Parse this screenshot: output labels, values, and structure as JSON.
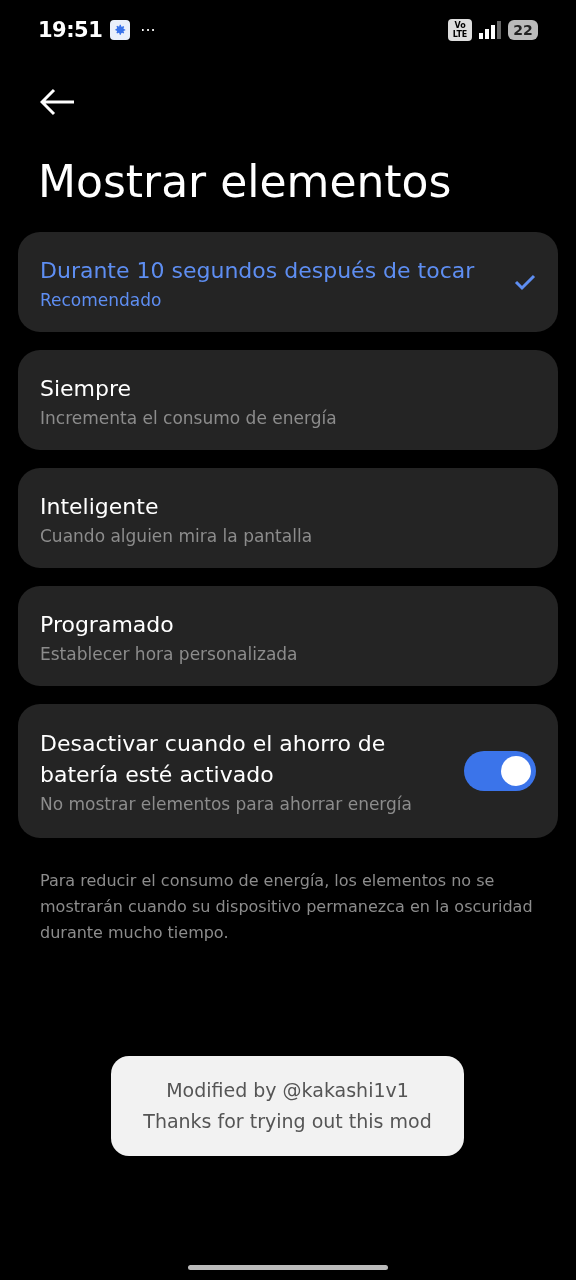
{
  "status_bar": {
    "time": "19:51",
    "more": "···",
    "volte": [
      "Vo",
      "LTE"
    ],
    "battery": "22"
  },
  "title": "Mostrar elementos",
  "options": [
    {
      "kind": "choice",
      "title": "Durante 10 segundos después de tocar",
      "subtitle": "Recomendado",
      "selected": true
    },
    {
      "kind": "choice",
      "title": "Siempre",
      "subtitle": "Incrementa el consumo de energía",
      "selected": false
    },
    {
      "kind": "choice",
      "title": "Inteligente",
      "subtitle": "Cuando alguien mira la pantalla",
      "selected": false
    },
    {
      "kind": "choice",
      "title": "Programado",
      "subtitle": "Establecer hora personalizada",
      "selected": false
    },
    {
      "kind": "toggle",
      "title": "Desactivar cuando el ahorro de batería esté activado",
      "subtitle": "No mostrar elementos para ahorrar energía",
      "on": true
    }
  ],
  "note": "Para reducir el consumo de energía, los elementos no se mostrarán cuando su dispositivo permanezca en la oscuridad durante mucho tiempo.",
  "toast": [
    "Modified by @kakashi1v1",
    "Thanks for trying out this mod"
  ]
}
